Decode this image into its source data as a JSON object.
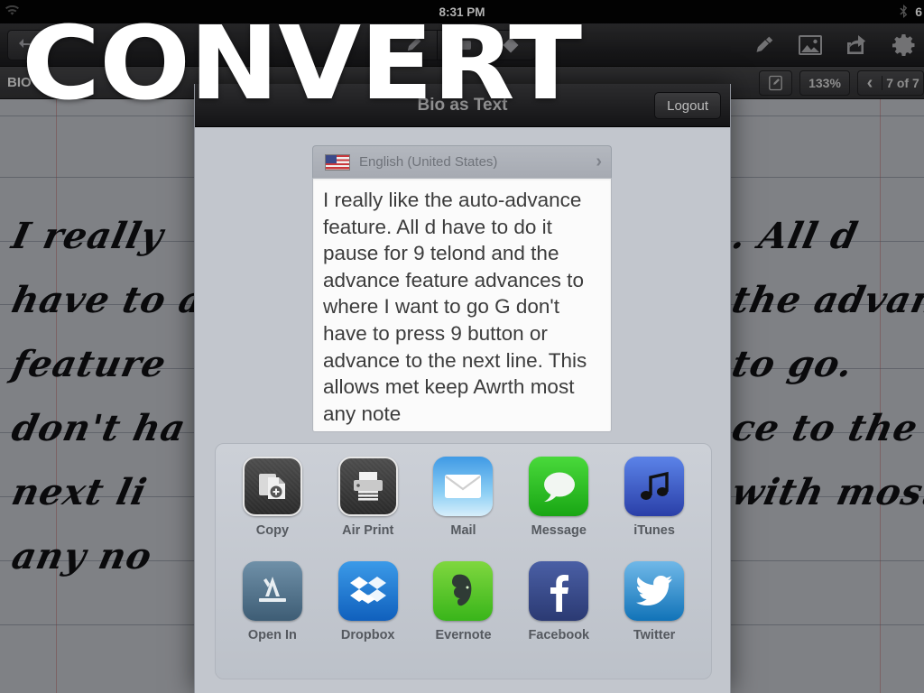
{
  "status_bar": {
    "wifi_icon": "wifi-icon",
    "time": "8:31 PM",
    "bluetooth_icon": "bluetooth-icon",
    "battery_text": "6"
  },
  "toolbar": {
    "undo_icon": "undo-arrow-icon",
    "tools": [
      {
        "name": "pen-tool-icon",
        "glyph": "✎"
      },
      {
        "name": "eraser-tool-icon",
        "glyph": "▭"
      },
      {
        "name": "shape-tool-icon",
        "glyph": "◆"
      }
    ],
    "right_icons": [
      {
        "name": "highlighter-icon",
        "glyph": "✒"
      },
      {
        "name": "photo-icon",
        "glyph": "Ὓb"
      },
      {
        "name": "share-icon",
        "glyph": "➦"
      },
      {
        "name": "gear-icon",
        "glyph": "⚙"
      }
    ]
  },
  "sub_toolbar": {
    "document_title": "BIO",
    "edit_icon": "edit-note-icon",
    "zoom_level": "133%",
    "prev_glyph": "‹",
    "page_indicator": "7 of 7"
  },
  "modal": {
    "title": "Bio as Text",
    "logout_label": "Logout",
    "language": {
      "flag": "us-flag-icon",
      "label": "English (United States)",
      "chevron": "›"
    },
    "ocr_text": "I really like the auto-advance feature. All d have to do it pause for 9 telond and the advance feature advances to where I want to go G don't have to press 9 button or advance to the next line. This allows met keep Awrth most any note"
  },
  "share_grid": [
    {
      "label": "Copy",
      "icon": "copy-icon",
      "class": "ic-copy"
    },
    {
      "label": "Air Print",
      "icon": "printer-icon",
      "class": "ic-print"
    },
    {
      "label": "Mail",
      "icon": "mail-envelope-icon",
      "class": "ic-mail"
    },
    {
      "label": "Message",
      "icon": "message-bubble-icon",
      "class": "ic-message"
    },
    {
      "label": "iTunes",
      "icon": "itunes-note-icon",
      "class": "ic-itunes"
    },
    {
      "label": "Open In",
      "icon": "app-store-icon",
      "class": "ic-openin"
    },
    {
      "label": "Dropbox",
      "icon": "dropbox-icon",
      "class": "ic-dropbox"
    },
    {
      "label": "Evernote",
      "icon": "evernote-elephant-icon",
      "class": "ic-evernote"
    },
    {
      "label": "Facebook",
      "icon": "facebook-icon",
      "class": "ic-facebook"
    },
    {
      "label": "Twitter",
      "icon": "twitter-bird-icon",
      "class": "ic-twitter"
    }
  ],
  "overlay": {
    "caption": "CONVERT"
  },
  "handwriting": {
    "left_lines": [
      "I really",
      "have to a",
      "feature",
      "don't ha",
      "next li",
      "any no"
    ],
    "right_lines": [
      ". All d",
      "the advance",
      "to go.",
      "ce to the",
      "with most"
    ]
  },
  "colors": {
    "accent_blue": "#3f9ae5",
    "green": "#19a614",
    "modal_bg": "#c2c6cd",
    "toolbar_dark": "#202022"
  }
}
